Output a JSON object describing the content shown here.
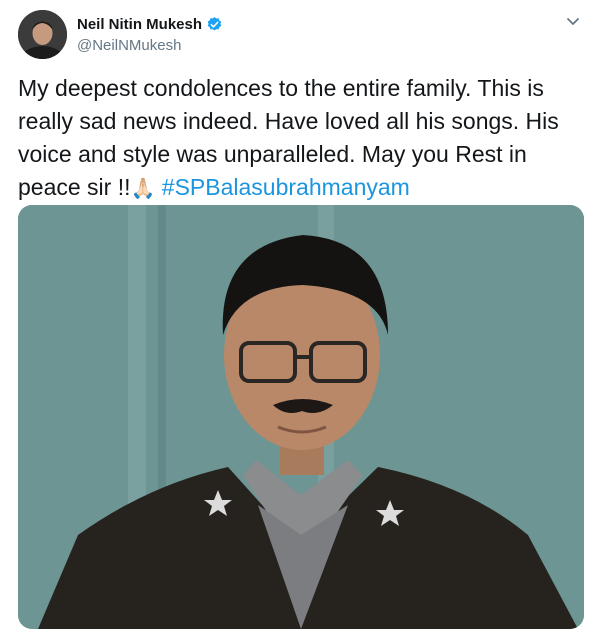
{
  "author": {
    "display_name": "Neil Nitin Mukesh",
    "handle": "@NeilNMukesh",
    "verified": true
  },
  "icons": {
    "verified": "verified-badge-icon",
    "menu": "chevron-down-icon"
  },
  "tweet": {
    "text_plain": "My deepest condolences to the entire family. This is really sad news indeed. Have loved all his songs. His voice and style was unparalleled. May you Rest in peace sir !!",
    "emoji": "🙏🏻",
    "hashtag": "#SPBalasubrahmanyam"
  },
  "colors": {
    "link": "#1b95e0",
    "verified": "#1da1f2",
    "secondary_text": "#657786"
  }
}
